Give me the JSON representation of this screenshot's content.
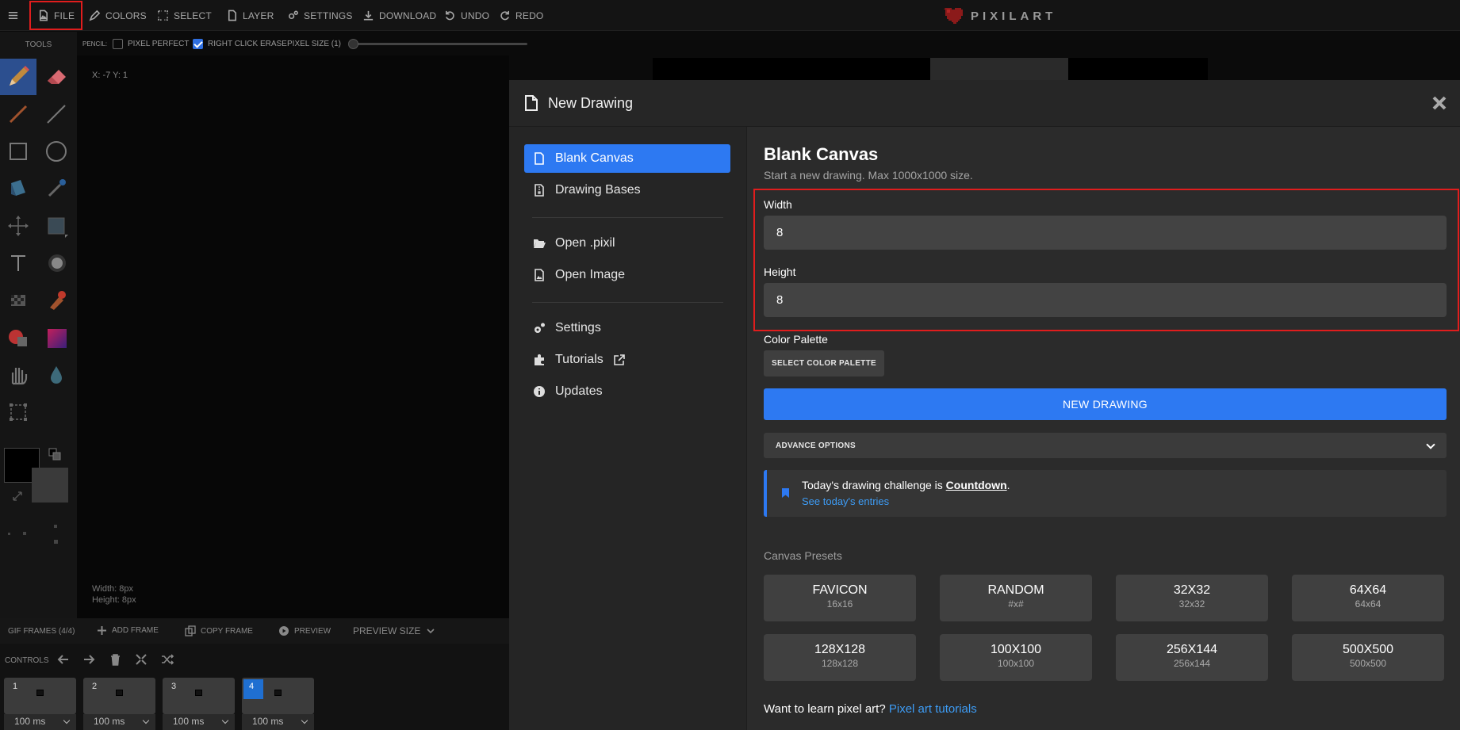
{
  "topbar": {
    "menu_icon": "hamburger-icon",
    "file": "FILE",
    "colors": "COLORS",
    "select": "SELECT",
    "layer": "LAYER",
    "settings": "SETTINGS",
    "download": "DOWNLOAD",
    "undo": "UNDO",
    "redo": "REDO",
    "logo_text": "PIXILART"
  },
  "optbar": {
    "tool_label": "PENCIL:",
    "pixel_perfect": "PIXEL PERFECT",
    "right_click_erase": "RIGHT CLICK ERASE",
    "pixel_size": "PIXEL SIZE (1)"
  },
  "tools": {
    "title": "TOOLS"
  },
  "canvas": {
    "coords": "X: -7 Y: 1",
    "width": "Width: 8px",
    "height": "Height: 8px"
  },
  "frames": {
    "gif_frames": "GIF FRAMES (4/4)",
    "add_frame": "ADD FRAME",
    "copy_frame": "COPY FRAME",
    "preview": "PREVIEW",
    "preview_size": "PREVIEW SIZE",
    "controls": "CONTROLS",
    "items": [
      {
        "num": "1",
        "ms": "100 ms"
      },
      {
        "num": "2",
        "ms": "100 ms"
      },
      {
        "num": "3",
        "ms": "100 ms"
      },
      {
        "num": "4",
        "ms": "100 ms"
      }
    ]
  },
  "modal": {
    "title": "New Drawing",
    "nav": {
      "blank_canvas": "Blank Canvas",
      "drawing_bases": "Drawing Bases",
      "open_pixil": "Open .pixil",
      "open_image": "Open Image",
      "settings": "Settings",
      "tutorials": "Tutorials",
      "updates": "Updates"
    },
    "heading": "Blank Canvas",
    "subtitle": "Start a new drawing. Max 1000x1000 size.",
    "width_label": "Width",
    "width_value": "8",
    "height_label": "Height",
    "height_value": "8",
    "palette_label": "Color Palette",
    "palette_button": "SELECT COLOR PALETTE",
    "new_drawing_button": "NEW DRAWING",
    "advance_options": "ADVANCE OPTIONS",
    "challenge_text": "Today's drawing challenge is ",
    "challenge_word": "Countdown",
    "challenge_link": "See today's entries",
    "presets_title": "Canvas Presets",
    "presets": [
      {
        "name": "FAVICON",
        "dims": "16x16"
      },
      {
        "name": "RANDOM",
        "dims": "#x#"
      },
      {
        "name": "32X32",
        "dims": "32x32"
      },
      {
        "name": "64X64",
        "dims": "64x64"
      },
      {
        "name": "128X128",
        "dims": "128x128"
      },
      {
        "name": "100X100",
        "dims": "100x100"
      },
      {
        "name": "256X144",
        "dims": "256x144"
      },
      {
        "name": "500X500",
        "dims": "500x500"
      }
    ],
    "learn_text": "Want to learn pixel art? ",
    "learn_link": "Pixel art tutorials"
  }
}
